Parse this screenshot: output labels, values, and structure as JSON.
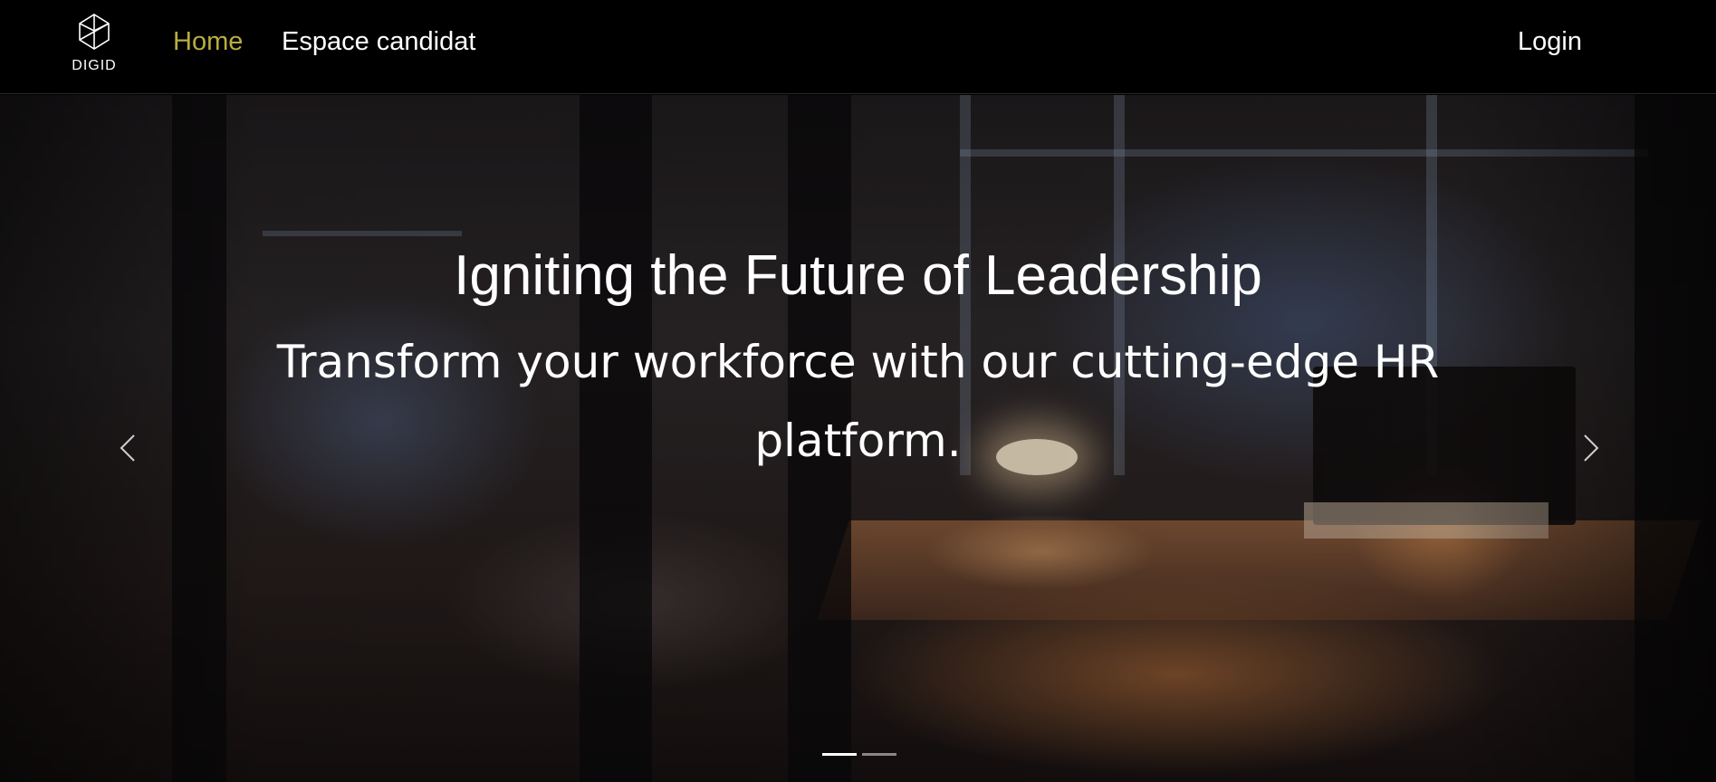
{
  "brand": {
    "logo_text": "DIGID"
  },
  "nav": {
    "home": "Home",
    "espace_candidat": "Espace candidat",
    "login": "Login",
    "active_color": "#b9ad3f"
  },
  "hero": {
    "title": "Igniting the Future of Leadership",
    "subtitle": "Transform your workforce with our cutting-edge HR platform.",
    "prev_icon": "chevron-left-icon",
    "next_icon": "chevron-right-icon",
    "slides_count": 2,
    "active_slide": 1
  }
}
